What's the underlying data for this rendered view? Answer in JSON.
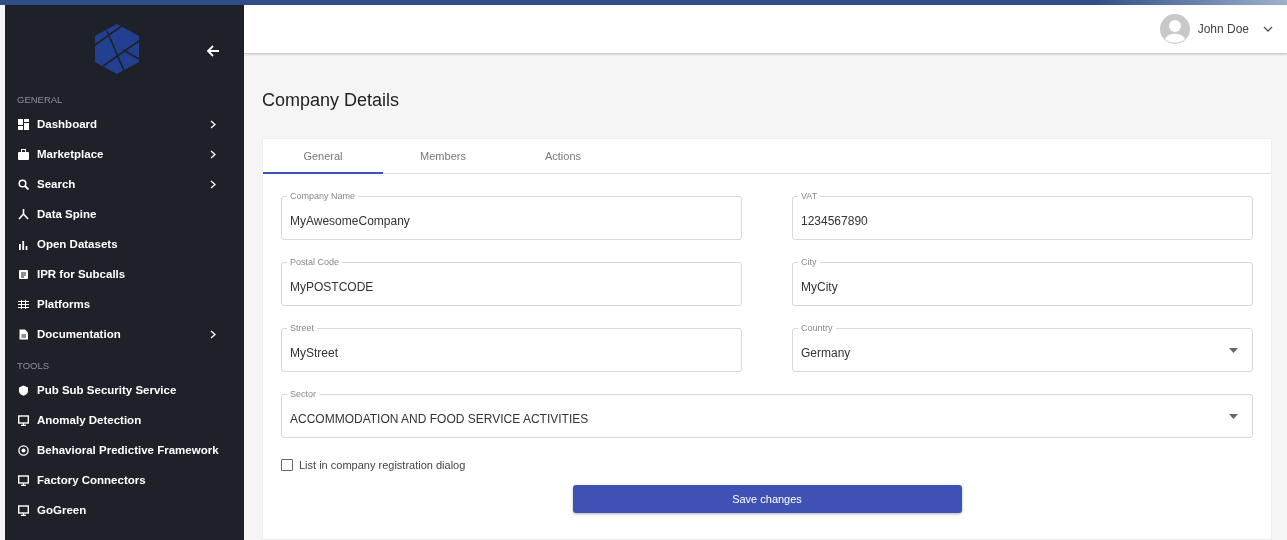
{
  "sidebar": {
    "sections": [
      {
        "title": "GENERAL",
        "items": [
          {
            "label": "Dashboard",
            "expandable": true
          },
          {
            "label": "Marketplace",
            "expandable": true
          },
          {
            "label": "Search",
            "expandable": true
          },
          {
            "label": "Data Spine",
            "expandable": false
          },
          {
            "label": "Open Datasets",
            "expandable": false
          },
          {
            "label": "IPR for Subcalls",
            "expandable": false
          },
          {
            "label": "Platforms",
            "expandable": false
          },
          {
            "label": "Documentation",
            "expandable": true
          }
        ]
      },
      {
        "title": "TOOLS",
        "items": [
          {
            "label": "Pub Sub Security Service",
            "expandable": false
          },
          {
            "label": "Anomaly Detection",
            "expandable": false
          },
          {
            "label": "Behavioral Predictive Framework",
            "expandable": false
          },
          {
            "label": "Factory Connectors",
            "expandable": false
          },
          {
            "label": "GoGreen",
            "expandable": false
          }
        ]
      }
    ]
  },
  "user": {
    "name": "John Doe"
  },
  "page": {
    "title": "Company Details"
  },
  "tabs": [
    {
      "label": "General",
      "selected": true
    },
    {
      "label": "Members",
      "selected": false
    },
    {
      "label": "Actions",
      "selected": false
    }
  ],
  "fields": [
    {
      "label": "Company Name",
      "value": "MyAwesomeCompany",
      "kind": "text",
      "wide": false
    },
    {
      "label": "VAT",
      "value": "1234567890",
      "kind": "text",
      "wide": false
    },
    {
      "label": "Postal Code",
      "value": "MyPOSTCODE",
      "kind": "text",
      "wide": false
    },
    {
      "label": "City",
      "value": "MyCity",
      "kind": "text",
      "wide": false
    },
    {
      "label": "Street",
      "value": "MyStreet",
      "kind": "text",
      "wide": false
    },
    {
      "label": "Country",
      "value": "Germany",
      "kind": "select",
      "wide": false
    },
    {
      "label": "Sector",
      "value": "ACCOMMODATION AND FOOD SERVICE ACTIVITIES",
      "kind": "select",
      "wide": true
    }
  ],
  "checkbox": {
    "label": "List in company registration dialog",
    "checked": false
  },
  "save_button": {
    "label": "Save changes"
  }
}
